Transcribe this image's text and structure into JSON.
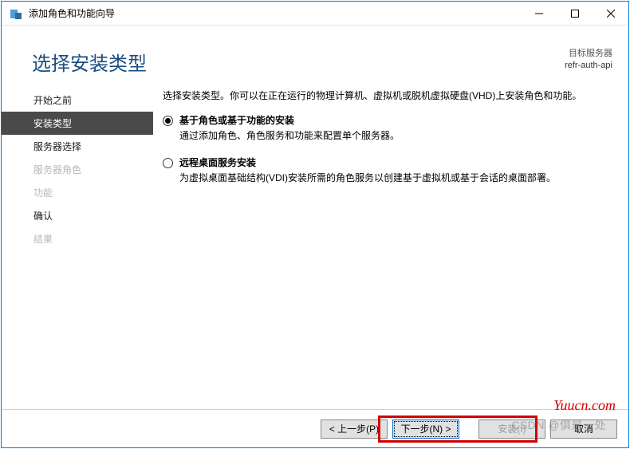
{
  "window": {
    "title": "添加角色和功能向导"
  },
  "header": {
    "page_title": "选择安装类型",
    "target_label": "目标服务器",
    "target_server": "refr-auth-api"
  },
  "sidebar": {
    "items": [
      {
        "label": "开始之前",
        "state": "done"
      },
      {
        "label": "安装类型",
        "state": "active"
      },
      {
        "label": "服务器选择",
        "state": "pending"
      },
      {
        "label": "服务器角色",
        "state": "disabled"
      },
      {
        "label": "功能",
        "state": "disabled"
      },
      {
        "label": "确认",
        "state": "pending"
      },
      {
        "label": "结果",
        "state": "disabled"
      }
    ]
  },
  "content": {
    "intro": "选择安装类型。你可以在正在运行的物理计算机、虚拟机或脱机虚拟硬盘(VHD)上安装角色和功能。",
    "options": [
      {
        "title": "基于角色或基于功能的安装",
        "desc": "通过添加角色、角色服务和功能来配置单个服务器。",
        "selected": true
      },
      {
        "title": "远程桌面服务安装",
        "desc": "为虚拟桌面基础结构(VDI)安装所需的角色服务以创建基于虚拟机或基于会话的桌面部署。",
        "selected": false
      }
    ]
  },
  "buttons": {
    "previous": "< 上一步(P)",
    "next": "下一步(N) >",
    "install": "安装(I)",
    "cancel": "取消"
  },
  "watermarks": {
    "csdn": "CSDN @俱是一处",
    "yuucn": "Yuucn.com"
  },
  "icons": {
    "app": "server-manager-icon",
    "minimize": "minimize-icon",
    "maximize": "maximize-icon",
    "close": "close-icon"
  }
}
